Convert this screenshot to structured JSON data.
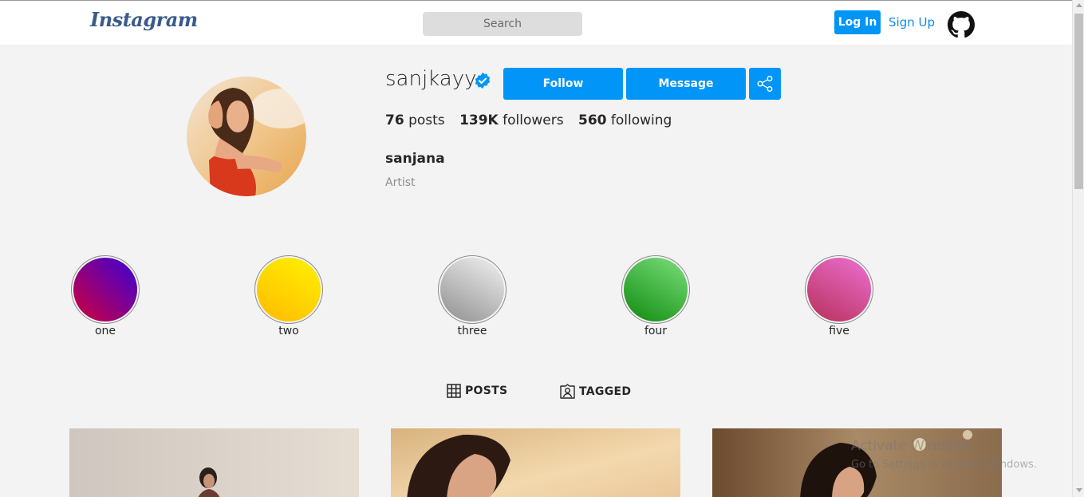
{
  "navbar": {
    "logo": "Instagram",
    "search_placeholder": "Search",
    "login_label": "Log In",
    "signup_label": "Sign Up",
    "github_icon": "github-icon"
  },
  "profile": {
    "username": "sanjkayy",
    "verified": true,
    "follow_label": "Follow",
    "message_label": "Message",
    "share_icon": "share-icon",
    "stats": {
      "posts_count": "76",
      "posts_label": "posts",
      "followers_count": "139K",
      "followers_label": "followers",
      "following_count": "560",
      "following_label": "following"
    },
    "full_name": "sanjana",
    "bio": "Artist"
  },
  "highlights": [
    {
      "label": "one",
      "colors": [
        "#d0003a",
        "#3b00d8"
      ]
    },
    {
      "label": "two",
      "colors": [
        "#ffba00",
        "#fff200"
      ]
    },
    {
      "label": "three",
      "colors": [
        "#8f8f8f",
        "#f2f2f2"
      ]
    },
    {
      "label": "four",
      "colors": [
        "#0f8a0f",
        "#7be07b"
      ]
    },
    {
      "label": "five",
      "colors": [
        "#b8305a",
        "#ec70d2"
      ]
    }
  ],
  "tabs": {
    "posts_label": "POSTS",
    "tagged_label": "TAGGED"
  },
  "accent_color": "#0095f6",
  "watermark": {
    "title": "Activate Windows",
    "subtitle": "Go to Settings to activate Windows."
  }
}
